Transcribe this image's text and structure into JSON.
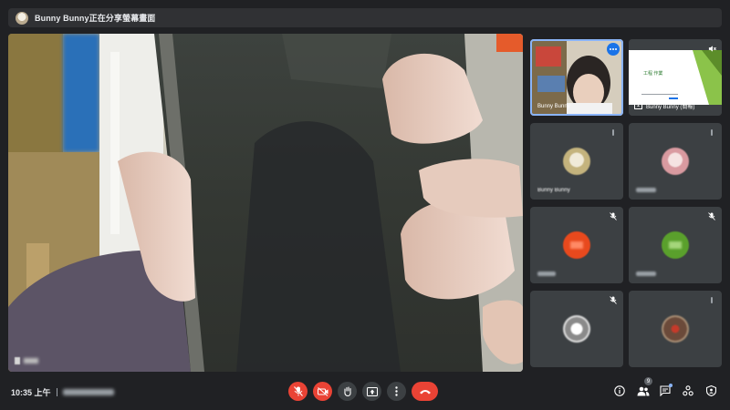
{
  "banner": {
    "text": "Bunny Bunny正在分享螢幕畫面"
  },
  "main": {
    "presenter_name_blurred": true
  },
  "tiles": [
    {
      "name": "Bunny Bunny",
      "has_video": true,
      "muted": false
    },
    {
      "name": "Bunny Bunny (簡報)",
      "has_video": true,
      "muted": true,
      "screen_text": "工程 作業"
    },
    {
      "name": "Bunny Bunny",
      "has_video": false,
      "muted": false,
      "avatar_color": "#d9cfae"
    },
    {
      "name": "",
      "has_video": false,
      "muted": false,
      "avatar_color": "#d99aa0"
    },
    {
      "name": "",
      "has_video": false,
      "muted": true,
      "avatar_color": "#e8491d"
    },
    {
      "name": "",
      "has_video": false,
      "muted": true,
      "avatar_color": "#5aa02c"
    },
    {
      "name": "",
      "has_video": false,
      "muted": true,
      "avatar_color": "#9a9a9a"
    },
    {
      "name": "",
      "has_video": false,
      "muted": false,
      "avatar_color": "#7a5a48"
    }
  ],
  "footer": {
    "time": "10:35 上午",
    "participant_count": "9"
  },
  "colors": {
    "background": "#202124",
    "tile": "#3c4043",
    "danger": "#ea4335",
    "accent": "#8ab4f8"
  },
  "icons": {
    "mic": "mic-off-icon",
    "camera": "camera-off-icon",
    "hand": "raise-hand-icon",
    "present": "present-now-icon",
    "more": "more-options-icon",
    "end": "end-call-icon",
    "info": "info-icon",
    "people": "people-icon",
    "chat": "chat-icon",
    "activities": "activities-icon",
    "host": "host-controls-icon"
  }
}
